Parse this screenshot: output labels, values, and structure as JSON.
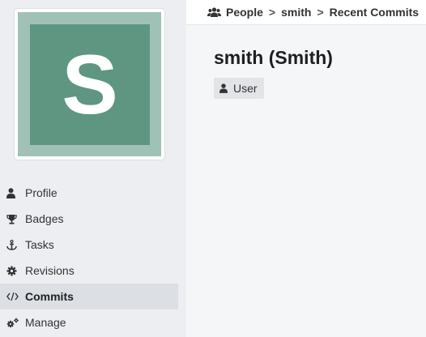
{
  "avatar": {
    "letter": "S"
  },
  "breadcrumb": {
    "items": [
      "People",
      "smith",
      "Recent Commits"
    ],
    "separator": ">"
  },
  "profile": {
    "title": "smith (Smith)",
    "badge": "User"
  },
  "sidebar": {
    "items": [
      {
        "label": "Profile",
        "icon": "user-icon"
      },
      {
        "label": "Badges",
        "icon": "trophy-icon"
      },
      {
        "label": "Tasks",
        "icon": "anchor-icon"
      },
      {
        "label": "Revisions",
        "icon": "gear-icon"
      },
      {
        "label": "Commits",
        "icon": "code-icon",
        "active": true
      },
      {
        "label": "Manage",
        "icon": "cogs-icon"
      }
    ]
  },
  "colors": {
    "avatar_outer": "#a0c2b6",
    "avatar_inner": "#5e9682",
    "sidebar_bg": "#eceef1",
    "active_item_bg": "#dcdfe3"
  }
}
